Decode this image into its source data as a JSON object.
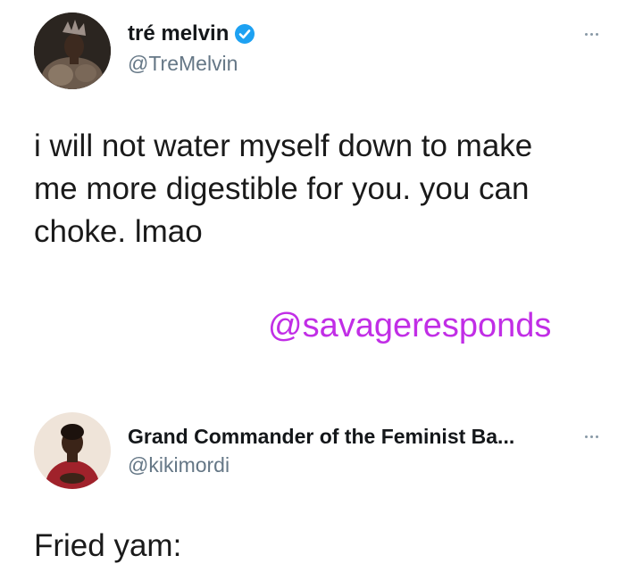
{
  "tweet1": {
    "display_name": "tré melvin",
    "handle": "@TreMelvin",
    "text": "i will not water myself down to make\nme more digestible for you. you can\nchoke. lmao",
    "verified": true,
    "more_icon": "more-horizontal-icon"
  },
  "watermark": "@savageresponds",
  "tweet2": {
    "display_name": "Grand Commander of the Feminist Ba...",
    "handle": "@kikimordi",
    "text": "Fried yam:",
    "more_icon": "more-horizontal-icon"
  },
  "colors": {
    "verified_badge": "#1da1f2",
    "watermark": "#c12ee6",
    "handle": "#657786"
  }
}
